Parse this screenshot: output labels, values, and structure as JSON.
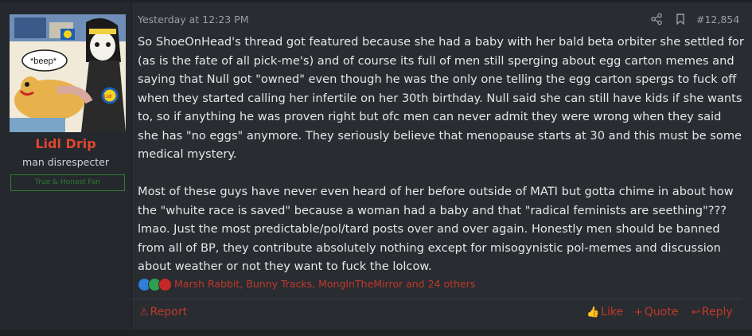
{
  "user": {
    "name": "Lidl Drip",
    "title": "man disrespecter",
    "banner": "True & Honest Fan",
    "avatar_caption": "*beep*",
    "avatar_badge": "Lidl"
  },
  "post": {
    "date": "Yesterday at 12:23 PM",
    "number": "#12,854",
    "paragraphs": [
      "So ShoeOnHead's thread got featured because she had a baby with her bald beta orbiter she settled for (as is the fate of all pick-me's) and of course its full of men still sperging about egg carton memes and saying that Null got \"owned\" even though he was the only one telling the egg carton spergs to fuck off when they started calling her infertile on her 30th birthday. Null said she can still have kids if she wants to, so if anything he was proven right but ofc men can never admit they were wrong when they said she has \"no eggs\" anymore. They seriously believe that menopause starts at 30 and this must be some medical mystery.",
      "Most of these guys have never even heard of her before outside of MATI but gotta chime in about how the \"whuite race is saved\" because a woman had a baby and that \"radical feminists are seething\"??? lmao. Just the most predictable/pol/tard posts over and over again. Honestly men should be banned from all of BP, they contribute absolutely nothing except for misogynistic pol-memes and discussion about weather or not they want to fuck the lolcow."
    ]
  },
  "reactions": {
    "icons": [
      "like-icon",
      "check-icon",
      "heart-icon"
    ],
    "users_text": "Marsh Rabbit, Bunny Tracks, MongInTheMirror and 24 others"
  },
  "actions": {
    "report": "Report",
    "like": "Like",
    "quote": "Quote",
    "reply": "Reply"
  },
  "colors": {
    "background": "#292c31",
    "username": "#e0462f",
    "accent": "#c0392b",
    "banner": "#2e7d32"
  }
}
